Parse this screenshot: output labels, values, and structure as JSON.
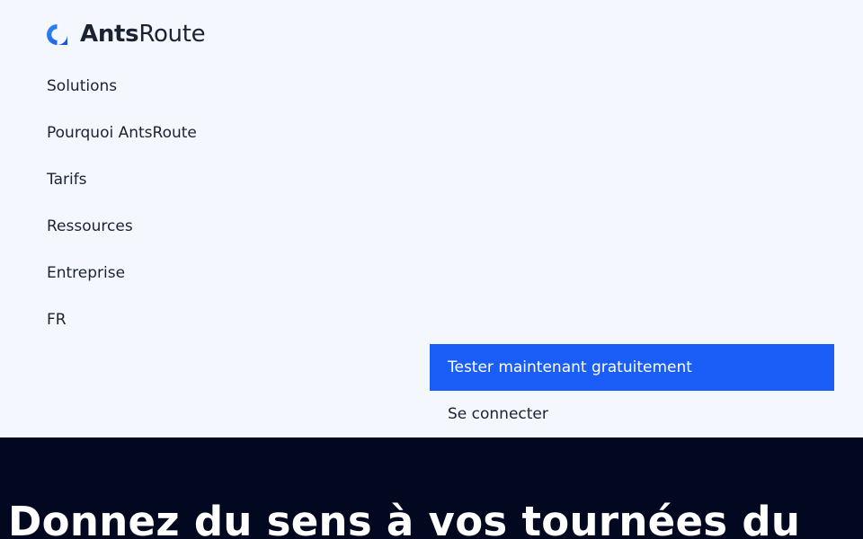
{
  "brand": {
    "name_strong": "Ants",
    "name_light": "Route",
    "logo_icon": "antsroute-logo-icon",
    "color_primary": "#1a5ef7",
    "color_dark": "#020820"
  },
  "nav": {
    "items": [
      {
        "label": "Solutions"
      },
      {
        "label": "Pourquoi AntsRoute"
      },
      {
        "label": "Tarifs"
      },
      {
        "label": "Ressources"
      },
      {
        "label": "Entreprise"
      },
      {
        "label": "FR"
      }
    ]
  },
  "actions": {
    "primary_label": "Tester maintenant gratuitement",
    "secondary_label": "Se connecter"
  },
  "hero": {
    "title": "Donnez du sens à vos tournées du"
  }
}
